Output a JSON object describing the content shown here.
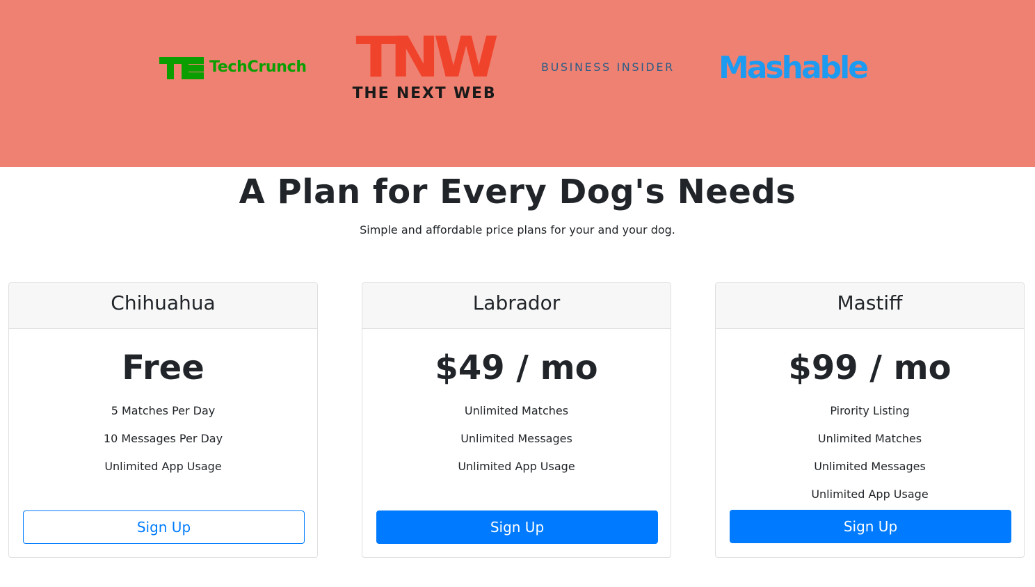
{
  "press": {
    "background": "#ef8172",
    "logos": {
      "techcrunch": {
        "mark": "TC",
        "word": "TechCrunch",
        "color": "#0a9e01"
      },
      "tnw": {
        "mark": "TNW",
        "sub": "THE NEXT WEB",
        "color": "#f0432b"
      },
      "business_insider": {
        "word": "BUSINESS INSIDER",
        "color": "#2c5d86"
      },
      "mashable": {
        "word": "Mashable",
        "color": "#1d9bf0"
      }
    }
  },
  "pricing": {
    "title": "A Plan for Every Dog's Needs",
    "subtitle": "Simple and affordable price plans for your and your dog.",
    "plans": [
      {
        "name": "Chihuahua",
        "price": "Free",
        "features": [
          "5 Matches Per Day",
          "10 Messages Per Day",
          "Unlimited App Usage"
        ],
        "button_label": "Sign Up",
        "button_style": "outline"
      },
      {
        "name": "Labrador",
        "price": "$49 / mo",
        "features": [
          "Unlimited Matches",
          "Unlimited Messages",
          "Unlimited App Usage"
        ],
        "button_label": "Sign Up",
        "button_style": "solid"
      },
      {
        "name": "Mastiff",
        "price": "$99 / mo",
        "features": [
          "Pirority Listing",
          "Unlimited Matches",
          "Unlimited Messages",
          "Unlimited App Usage"
        ],
        "button_label": "Sign Up",
        "button_style": "solid"
      }
    ],
    "accent_color": "#007bff"
  }
}
